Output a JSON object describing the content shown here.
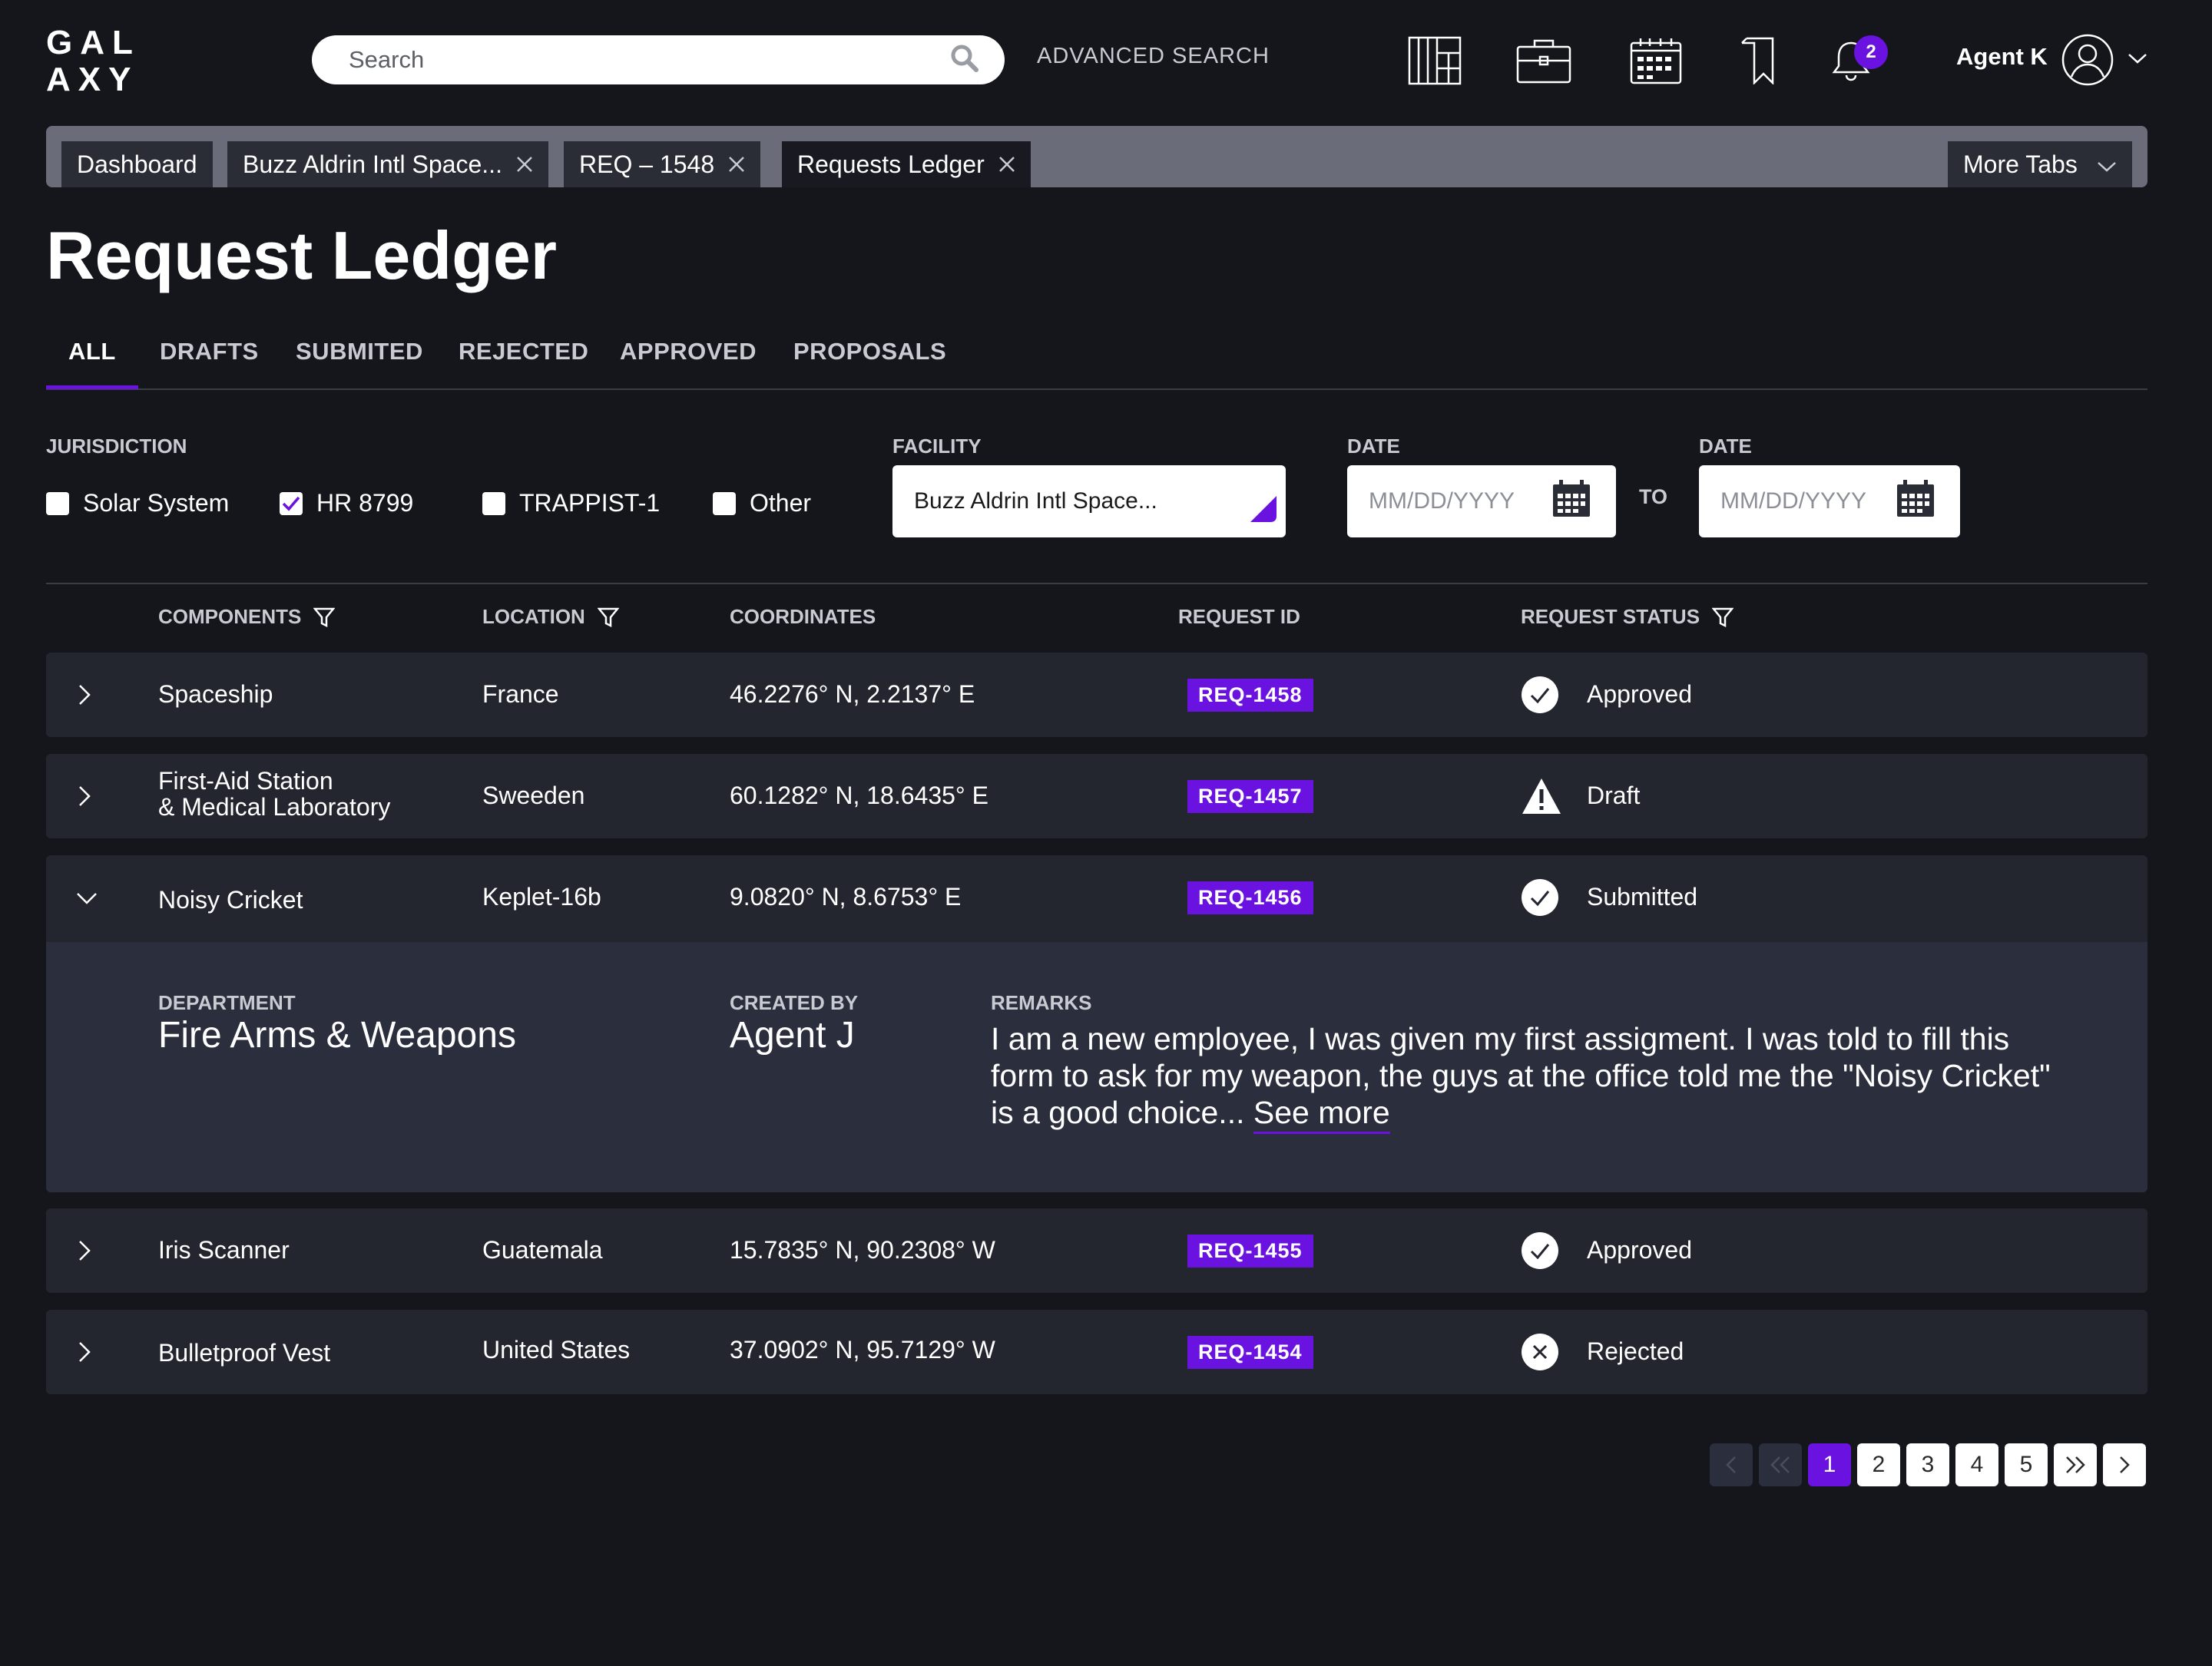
{
  "header": {
    "logo_line1": "GAL",
    "logo_line2": "AXY",
    "search_placeholder": "Search",
    "advanced_search": "ADVANCED SEARCH",
    "notification_count": "2",
    "user_name": "Agent K",
    "icons": [
      "grid-icon",
      "briefcase-icon",
      "calendar-icon",
      "bookmark-icon",
      "bell-icon",
      "user-avatar-icon",
      "chevron-down-icon"
    ]
  },
  "tabs": [
    {
      "label": "Dashboard",
      "closable": false
    },
    {
      "label": "Buzz Aldrin Intl Space...",
      "closable": true
    },
    {
      "label": "REQ – 1548",
      "closable": true
    },
    {
      "label": "Requests Ledger",
      "closable": true,
      "active": true
    }
  ],
  "more_tabs": "More Tabs",
  "page_title": "Request Ledger",
  "subtabs": [
    "ALL",
    "DRAFTS",
    "SUBMITED",
    "REJECTED",
    "APPROVED",
    "PROPOSALS"
  ],
  "active_subtab": "ALL",
  "filters": {
    "jurisdiction_label": "JURISDICTION",
    "jurisdictions": [
      {
        "label": "Solar System",
        "checked": false
      },
      {
        "label": "HR 8799",
        "checked": true
      },
      {
        "label": "TRAPPIST-1",
        "checked": false
      },
      {
        "label": "Other",
        "checked": false
      }
    ],
    "facility_label": "FACILITY",
    "facility_value": "Buzz Aldrin Intl Space...",
    "date_label_from": "DATE",
    "date_label_to": "DATE",
    "date_placeholder": "MM/DD/YYYY",
    "to_label": "TO"
  },
  "table": {
    "columns": [
      "COMPONENTS",
      "LOCATION",
      "COORDINATES",
      "REQUEST ID",
      "REQUEST STATUS"
    ],
    "rows": [
      {
        "component": "Spaceship",
        "component_line2": "",
        "location": "France",
        "coordinates": "46.2276° N, 2.2137° E",
        "request_id": "REQ-1458",
        "status": "Approved",
        "status_icon": "check-circle-icon"
      },
      {
        "component": "First-Aid Station",
        "component_line2": "& Medical Laboratory",
        "location": "Sweeden",
        "coordinates": "60.1282° N, 18.6435° E",
        "request_id": "REQ-1457",
        "status": "Draft",
        "status_icon": "warning-icon"
      },
      {
        "component": "Noisy Cricket",
        "component_line2": "",
        "location": "Keplet-16b",
        "coordinates": "9.0820° N, 8.6753° E",
        "request_id": "REQ-1456",
        "status": "Submitted",
        "status_icon": "check-circle-icon"
      },
      {
        "component": "Iris Scanner",
        "component_line2": "",
        "location": "Guatemala",
        "coordinates": "15.7835° N, 90.2308° W",
        "request_id": "REQ-1455",
        "status": "Approved",
        "status_icon": "check-circle-icon"
      },
      {
        "component": "Bulletproof Vest",
        "component_line2": "",
        "location": "United States",
        "coordinates": "37.0902° N, 95.7129° W",
        "request_id": "REQ-1454",
        "status": "Rejected",
        "status_icon": "x-circle-icon"
      }
    ],
    "expanded": {
      "department_label": "DEPARTMENT",
      "department": "Fire Arms & Weapons",
      "created_by_label": "CREATED BY",
      "created_by": "Agent J",
      "remarks_label": "REMARKS",
      "remarks": "I am a new employee, I was given my first assigment. I was told to fill this form to ask for my weapon, the guys at the office told me the \"Noisy Cricket\" is a good choice...",
      "see_more": "See more"
    }
  },
  "pagination": {
    "pages": [
      "1",
      "2",
      "3",
      "4",
      "5"
    ],
    "current": "1"
  },
  "colors": {
    "accent": "#6a12e0",
    "background": "#15161c",
    "row": "#23252f",
    "tabbar": "#6a6c7a"
  }
}
